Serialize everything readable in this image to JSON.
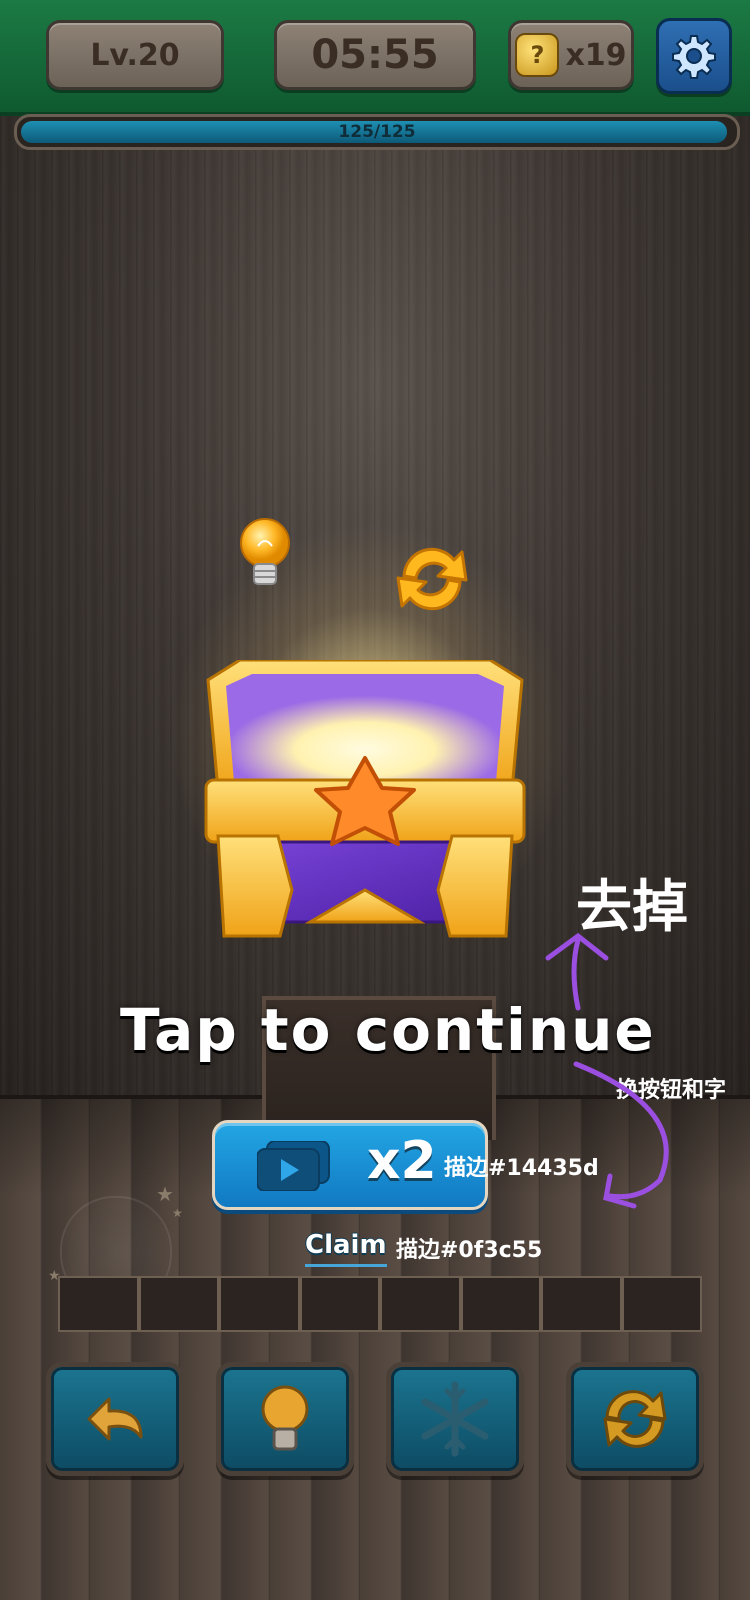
{
  "top_bar": {
    "level_label": "Lv.20",
    "timer": "05:55",
    "hint_count": "x19",
    "hint_icon": "question-block-icon",
    "settings_icon": "gear-icon"
  },
  "progress": {
    "text": "125/125",
    "fraction": 1.0
  },
  "rewards": {
    "items": [
      "lightbulb-icon",
      "refresh-icon"
    ]
  },
  "chest": {
    "icon": "treasure-chest-open-icon"
  },
  "tap_to_continue": "Tap to continue",
  "x2_button": {
    "label": "x2",
    "icon": "video-play-icon"
  },
  "claim_link": "Claim",
  "annotations": {
    "remove_note": "去掉",
    "change_note": "换按钮和字",
    "stroke_note_button": "描边#14435d",
    "stroke_note_claim": "描边#0f3c55",
    "arrow_color": "#9b4fe0"
  },
  "slots_count": 8,
  "tools": [
    {
      "name": "undo",
      "icon": "undo-arrow-icon"
    },
    {
      "name": "hint",
      "icon": "lightbulb-icon"
    },
    {
      "name": "freeze",
      "icon": "snowflake-icon"
    },
    {
      "name": "shuffle",
      "icon": "refresh-icon"
    }
  ],
  "colors": {
    "top_bar_green": "#1c7a44",
    "button_blue": "#1e94d6",
    "button_stroke": "#14435d",
    "claim_stroke": "#0f3c55",
    "tool_teal": "#176a85"
  }
}
